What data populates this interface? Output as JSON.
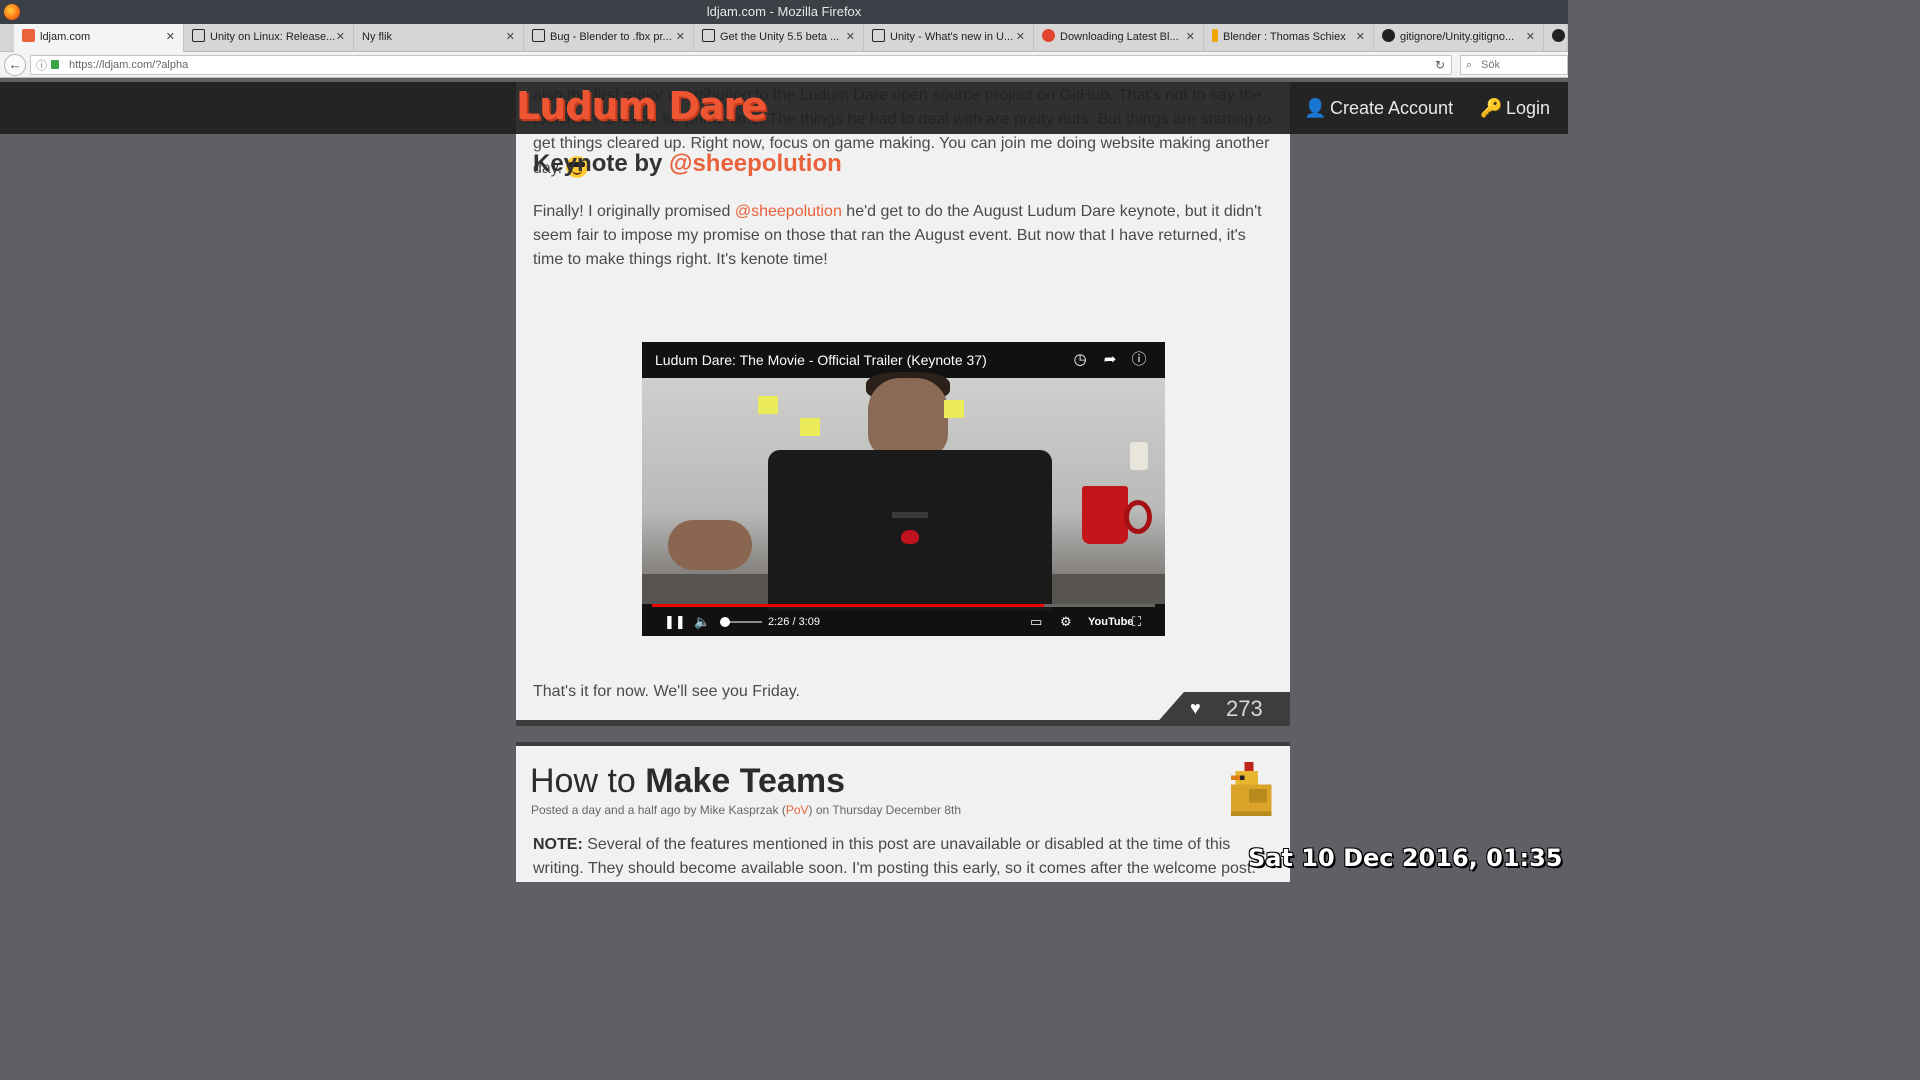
{
  "window": {
    "title": "ldjam.com - Mozilla Firefox"
  },
  "tabs": [
    {
      "label": "ldjam.com",
      "icon": "ludum-dare-icon",
      "color": "#e9623c"
    },
    {
      "label": "Unity on Linux: Release...",
      "icon": "unity-icon",
      "color": "#222222"
    },
    {
      "label": "Ny flik",
      "icon": "",
      "color": ""
    },
    {
      "label": "Bug - Blender to .fbx pr...",
      "icon": "unity-icon",
      "color": "#222222"
    },
    {
      "label": "Get the Unity 5.5 beta ...",
      "icon": "unity-icon",
      "color": "#222222"
    },
    {
      "label": "Unity - What's new in U...",
      "icon": "unity-icon",
      "color": "#222222"
    },
    {
      "label": "Downloading Latest Bl...",
      "icon": "ask-icon",
      "color": "#e2452e"
    },
    {
      "label": "Blender : Thomas Schiex",
      "icon": "launchpad-icon",
      "color": "#f0a500"
    },
    {
      "label": "gitignore/Unity.gitigno...",
      "icon": "github-icon",
      "color": "#222222"
    }
  ],
  "navbar": {
    "url": "https://ldjam.com/?alpha",
    "search_placeholder": "Sök"
  },
  "site": {
    "logo": "Ludum Dare",
    "create_account": "Create Account",
    "login": "Login"
  },
  "post": {
    "para1": "also the first major contribution to the Ludum Dare open source project on GitHub. That's not to say the toolchain is ready for prime time. The things he had to deal with are pretty nuts. But things are starting to get things cleared up. Right now, focus on game making. You can join me doing website making another day.",
    "heading_prefix": "Keynote by",
    "heading_mention": "@sheepolution",
    "para2_start": "Finally! I originally promised",
    "para2_mention": "@sheepolution",
    "para2_end": "he'd get to do the August Ludum Dare keynote, but it didn't seem fair to impose my promise on those that ran the August event. But now that I have returned, it's time to make things right. It's kenote time!",
    "closing": "That's it for now. We'll see you Friday.",
    "likes": "273"
  },
  "video": {
    "title": "Ludum Dare: The Movie - Official Trailer (Keynote 37)",
    "time": "2:26 / 3:09",
    "progress": 0.78,
    "youtube": "YouTube"
  },
  "post2": {
    "title_light": "How to",
    "title_bold": "Make Teams",
    "meta_start": "Posted a day and a half ago by Mike Kasprzak (",
    "meta_handle": "PoV",
    "meta_end": ") on Thursday December 8th",
    "note_label": "NOTE:",
    "note_text": "Several of the features mentioned in this post are unavailable or disabled at the time of this writing. They should become available soon. I'm posting this early, so it comes after the welcome post."
  },
  "overlay": {
    "datetime": "Sat 10 Dec 2016, 01:35"
  }
}
